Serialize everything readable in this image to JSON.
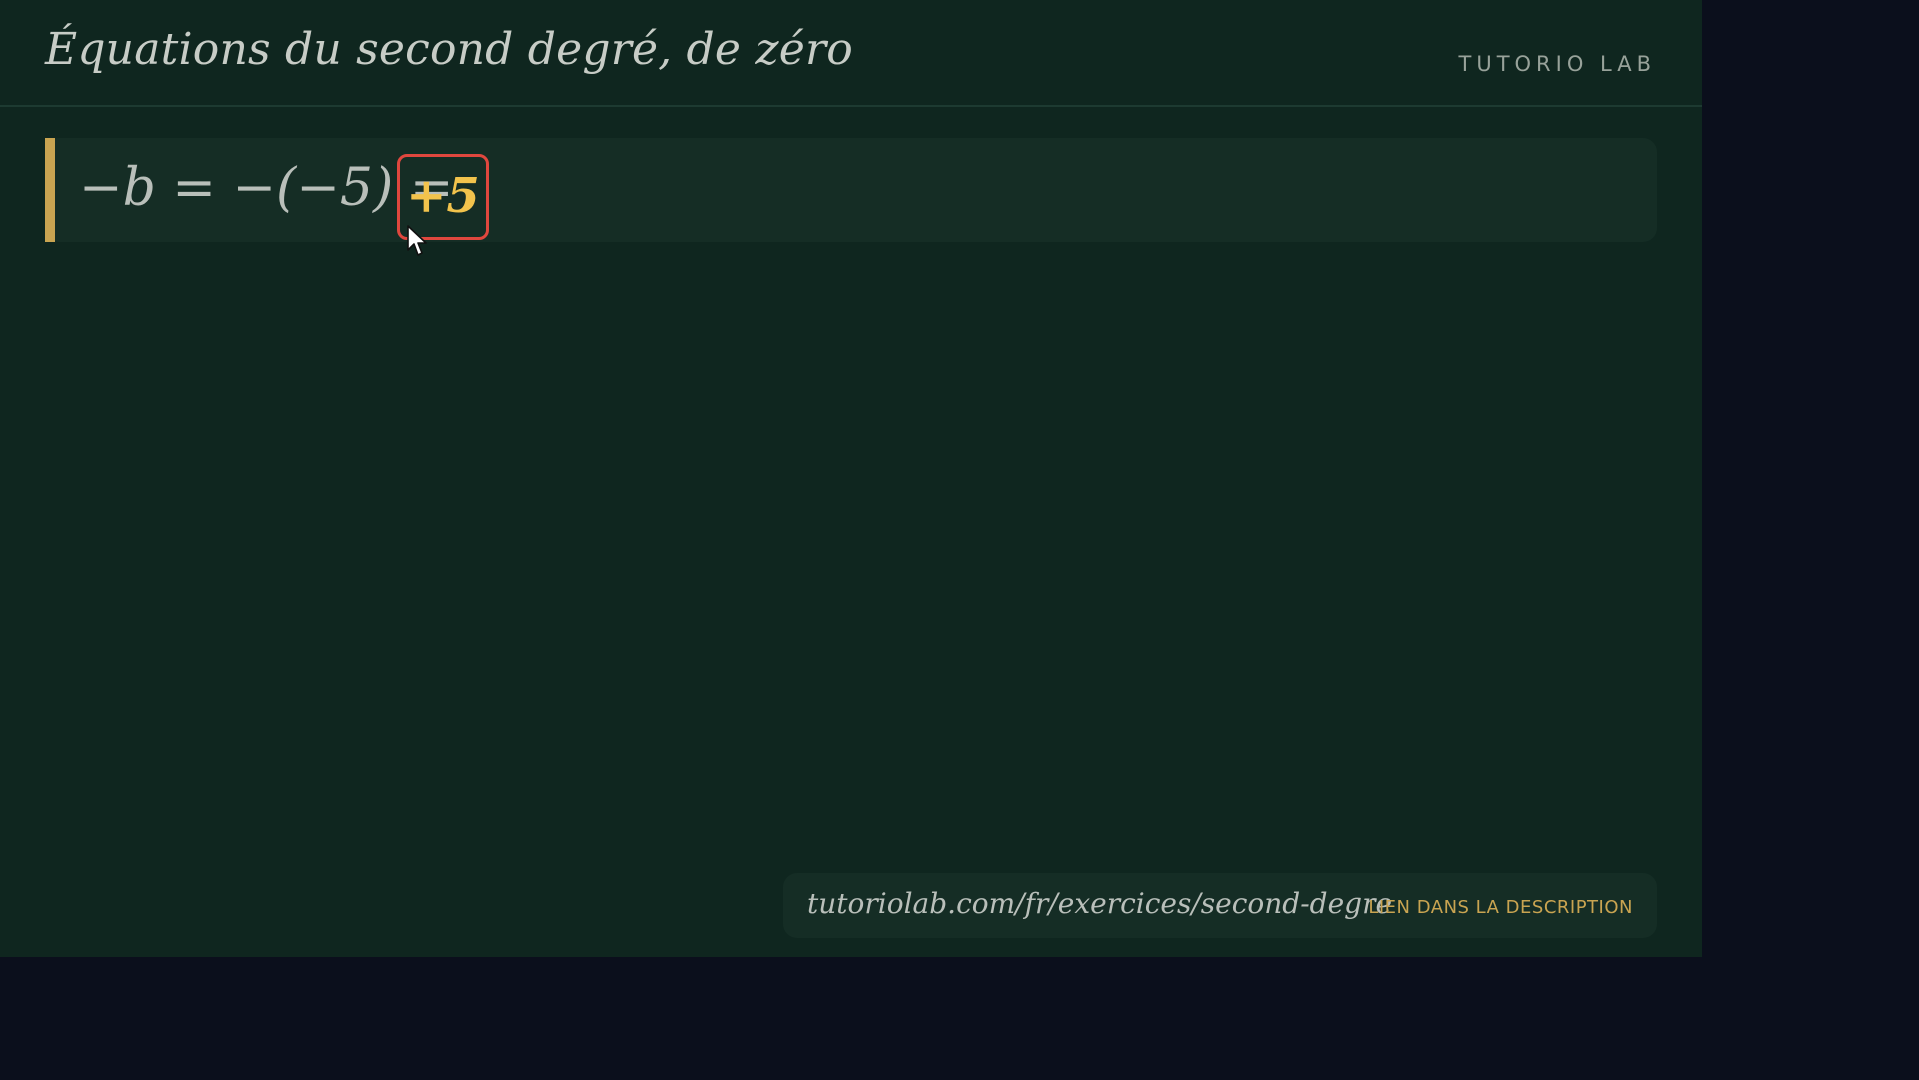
{
  "header": {
    "title": "Équations du second degré, de zéro",
    "brand": "TUTORIO LAB"
  },
  "equation": {
    "expression": "−b = −(−5) =",
    "result": "+5"
  },
  "footer": {
    "url": "tutoriolab.com/fr/exercices/second-degre",
    "note": "LIEN DANS LA DESCRIPTION"
  },
  "icons": {
    "cursor": "mouse-pointer-icon"
  },
  "colors": {
    "board": "#0f261f",
    "card": "#152d25",
    "accent": "#c9a451",
    "highlight_border": "#e0473e",
    "highlight_text": "#f2c34c",
    "outer_background": "#0b0f1c"
  }
}
